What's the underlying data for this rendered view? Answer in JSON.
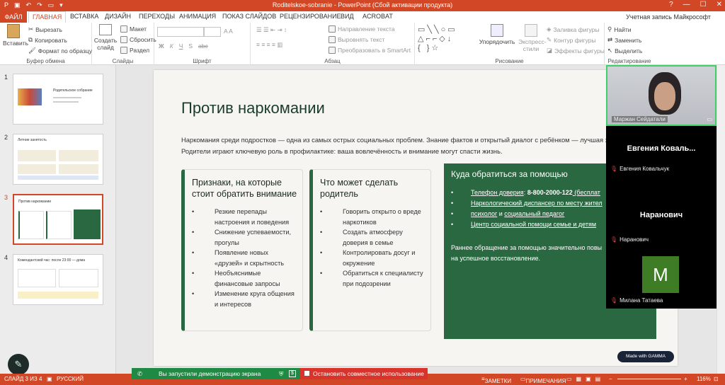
{
  "window": {
    "title": "Roditelskoe-sobranie - PowerPoint (Сбой активации продукта)",
    "controls": [
      "?",
      "—",
      "☐",
      "✕"
    ]
  },
  "tabs": {
    "file": "ФАЙЛ",
    "items": [
      "ГЛАВНАЯ",
      "ВСТАВКА",
      "ДИЗАЙН",
      "ПЕРЕХОДЫ",
      "АНИМАЦИЯ",
      "ПОКАЗ СЛАЙДОВ",
      "РЕЦЕНЗИРОВАНИЕ",
      "ВИД",
      "ACROBAT"
    ],
    "account": "Учетная запись Майкрософт"
  },
  "ribbon": {
    "clipboard": {
      "paste": "Вставить",
      "cut": "Вырезать",
      "copy": "Копировать",
      "format": "Формат по образцу",
      "label": "Буфер обмена"
    },
    "slides": {
      "create": "Создать слайд",
      "layout": "Макет",
      "reset": "Сбросить",
      "section": "Раздел",
      "label": "Слайды"
    },
    "font": {
      "label": "Шрифт",
      "bold": "Ж",
      "italic": "К",
      "underline": "Ч",
      "shadow": "S",
      "strike": "abc"
    },
    "paragraph": {
      "label": "Абзац",
      "direction": "Направление текста",
      "align": "Выровнять текст",
      "smartart": "Преобразовать в SmartArt"
    },
    "drawing": {
      "label": "Рисование",
      "arrange": "Упорядочить",
      "styles": "Экспресс-стили",
      "fill": "Заливка фигуры",
      "outline": "Контур фигуры",
      "effects": "Эффекты фигуры"
    },
    "editing": {
      "label": "Редактирование",
      "find": "Найти",
      "replace": "Заменить",
      "select": "Выделить"
    }
  },
  "thumbnails": [
    {
      "num": "1",
      "title": "Родительское собрание"
    },
    {
      "num": "2",
      "title": "Летние занятость"
    },
    {
      "num": "3",
      "title": "Против наркомании"
    },
    {
      "num": "4",
      "title": "Комендантский час: после 23:00 — дома"
    }
  ],
  "slide": {
    "title": "Против наркомании",
    "intro1": "Наркомания среди подростков — одна из самых острых социальных проблем. Знание фактов и открытый диалог с ребёнком — лучшая за",
    "intro2": "Родители играют ключевую роль в профилактике: ваша вовлечённость и внимание могут спасти жизнь.",
    "card1": {
      "title1": "Признаки, на которые",
      "title2": "стоит обратить внимание",
      "items": [
        "Резкие перепады",
        "настроения и поведения",
        "Снижение успеваемости,",
        "прогулы",
        "Появление новых",
        "«друзей» и скрытность",
        "Необъяснимые",
        "финансовые запросы",
        "Изменение круга общения",
        "и интересов"
      ]
    },
    "card2": {
      "title1": "Что может сделать",
      "title2": "родитель",
      "items": [
        "Говорить открыто о вреде",
        "наркотиков",
        "Создать атмосферу",
        "доверия в семье",
        "Контролировать досуг и",
        "окружение",
        "Обратиться к специалисту",
        "при подозрении"
      ]
    },
    "card3": {
      "title": "Куда обратиться за помощью",
      "l1a": "Телефон доверия",
      "l1b": ": ",
      "l1c": "8-800-2000-122",
      "l1d": " (бесплат",
      "l2": "Наркологический диспансер по месту жител",
      "l3a": "психолог",
      "l3b": " и ",
      "l3c": "социальный педагог",
      "l4": "Центр социальной помощи семье и детям",
      "note1": "Раннее обращение за помощью значительно повы",
      "note2": "на успешное восстановление."
    },
    "badge": "Made with GAMMA"
  },
  "participants": [
    {
      "name": "Маржан Сейдатали",
      "type": "video"
    },
    {
      "name": "Евгения Ковальчук",
      "display": "Евгения  Коваль..."
    },
    {
      "name": "Наранович",
      "display": "Наранович"
    },
    {
      "name": "Милана Татаева",
      "initial": "M"
    }
  ],
  "share": {
    "active": "Вы запустили демонстрацию экрана",
    "stop": "Остановить совместное использование"
  },
  "status": {
    "slide": "СЛАЙД 3 ИЗ 4",
    "lang": "РУССКИЙ",
    "notes": "ЗАМЕТКИ",
    "comments": "ПРИМЕЧАНИЯ",
    "zoom": "116%"
  }
}
